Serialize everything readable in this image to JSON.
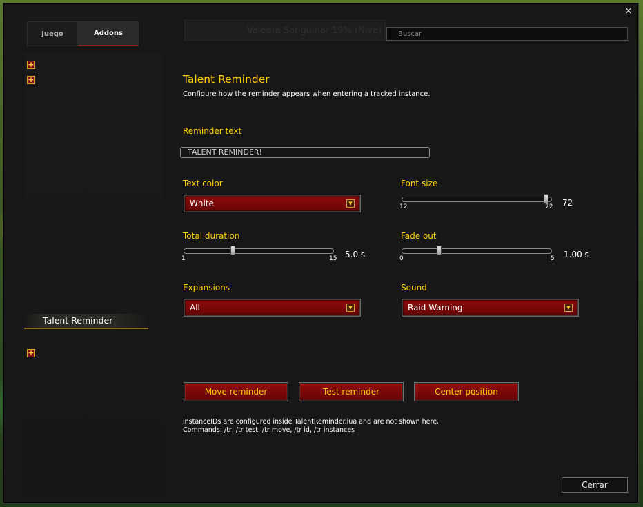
{
  "window": {
    "close_glyph": "×"
  },
  "tabs": [
    {
      "label": "Juego",
      "active": false
    },
    {
      "label": "Addons",
      "active": true
    }
  ],
  "header": {
    "ghost_text": "Valeera Sanguinar 19% (Nive)"
  },
  "search": {
    "placeholder": "Buscar"
  },
  "sidebar": {
    "expand_glyph": "+",
    "selected_item": "Talent Reminder"
  },
  "panel": {
    "title": "Talent Reminder",
    "description": "Configure how the reminder appears when entering a tracked instance.",
    "reminder_text": {
      "label": "Reminder text",
      "value": "TALENT REMINDER!"
    },
    "text_color": {
      "label": "Text color",
      "value": "White"
    },
    "font_size": {
      "label": "Font size",
      "min": "12",
      "max": "72",
      "value": "72",
      "fraction": 0.98
    },
    "total_duration": {
      "label": "Total duration",
      "min": "1",
      "max": "15",
      "value": "5.0 s",
      "fraction": 0.32
    },
    "fade_out": {
      "label": "Fade out",
      "min": "0",
      "max": "5",
      "value": "1.00 s",
      "fraction": 0.24
    },
    "expansions": {
      "label": "Expansions",
      "value": "All"
    },
    "sound": {
      "label": "Sound",
      "value": "Raid Warning"
    },
    "buttons": {
      "move": "Move reminder",
      "test": "Test reminder",
      "center": "Center position"
    },
    "notes": [
      "instanceIDs are configured inside TalentReminder.lua and are not shown here.",
      "Commands: /tr, /tr test, /tr move, /tr id, /tr instances"
    ]
  },
  "footer": {
    "close_label": "Cerrar"
  },
  "colors": {
    "accent_gold": "#ffd100",
    "button_red": "#8e0a0a"
  },
  "icons": [
    "close-icon",
    "expand-plus-icon",
    "dropdown-arrow-icon"
  ]
}
